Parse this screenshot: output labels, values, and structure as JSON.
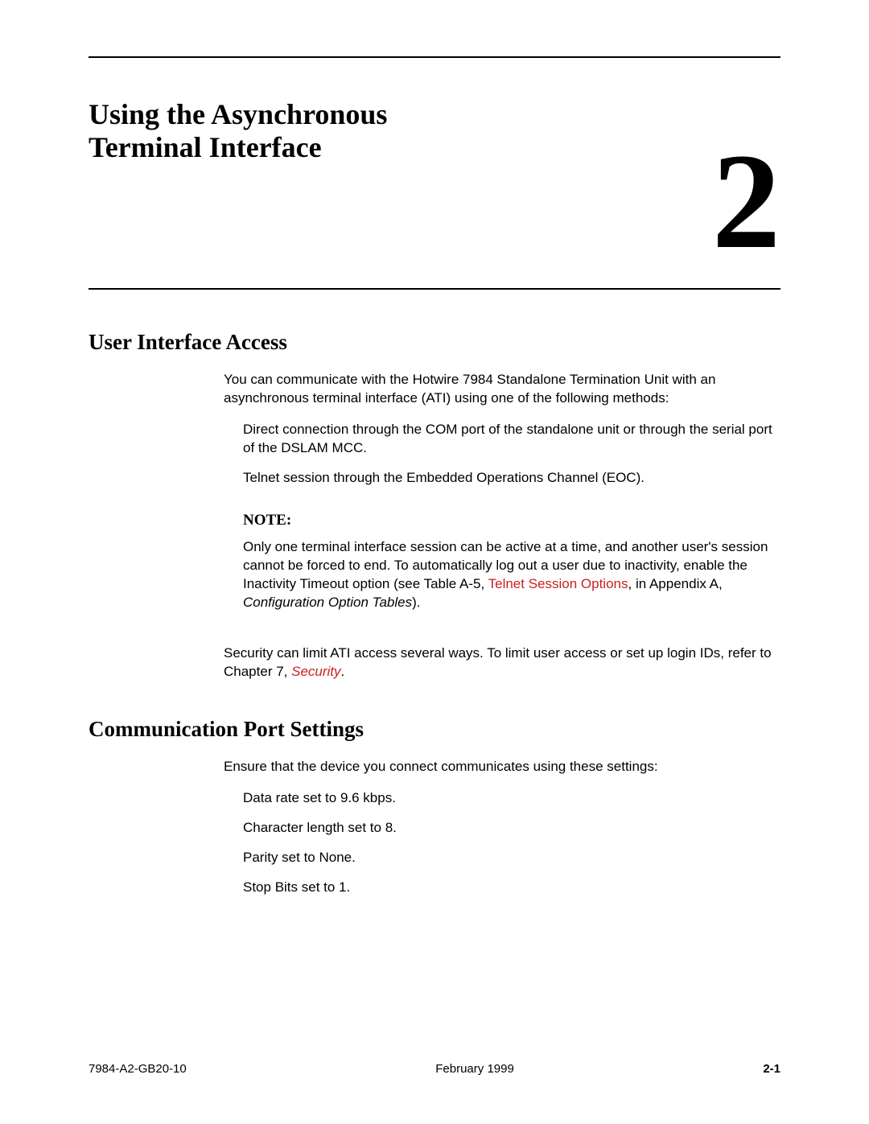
{
  "chapter": {
    "title": "Using the Asynchronous Terminal Interface",
    "number": "2"
  },
  "section1": {
    "heading": "User Interface Access",
    "intro": "You can communicate with the Hotwire 7984 Standalone Termination Unit with an asynchronous terminal interface (ATI) using one of the following methods:",
    "items": [
      "Direct connection through the COM port of the standalone unit or through the serial port of the DSLAM MCC.",
      "Telnet session through the Embedded Operations Channel (EOC)."
    ],
    "note_label": "NOTE:",
    "note_text_pre": "Only one terminal interface session can be active at a time, and another user's session cannot be forced to end. To automatically log out a user due to inactivity, enable the Inactivity Timeout option (see Table A-5, ",
    "note_link": "Telnet Session Options",
    "note_text_mid": ", in Appendix A, ",
    "note_italic": "Configuration Option Tables",
    "note_text_post": ").",
    "security_pre": "Security can limit ATI access several ways. To limit user access or set up login IDs, refer to Chapter 7, ",
    "security_link": "Security",
    "security_post": "."
  },
  "section2": {
    "heading": "Communication Port Settings",
    "intro": "Ensure that the device you connect communicates using these settings:",
    "items": [
      "Data rate set to 9.6 kbps.",
      "Character length set to 8.",
      "Parity set to None.",
      "Stop Bits set to 1."
    ]
  },
  "footer": {
    "doc_id": "7984-A2-GB20-10",
    "date": "February 1999",
    "page": "2-1"
  }
}
